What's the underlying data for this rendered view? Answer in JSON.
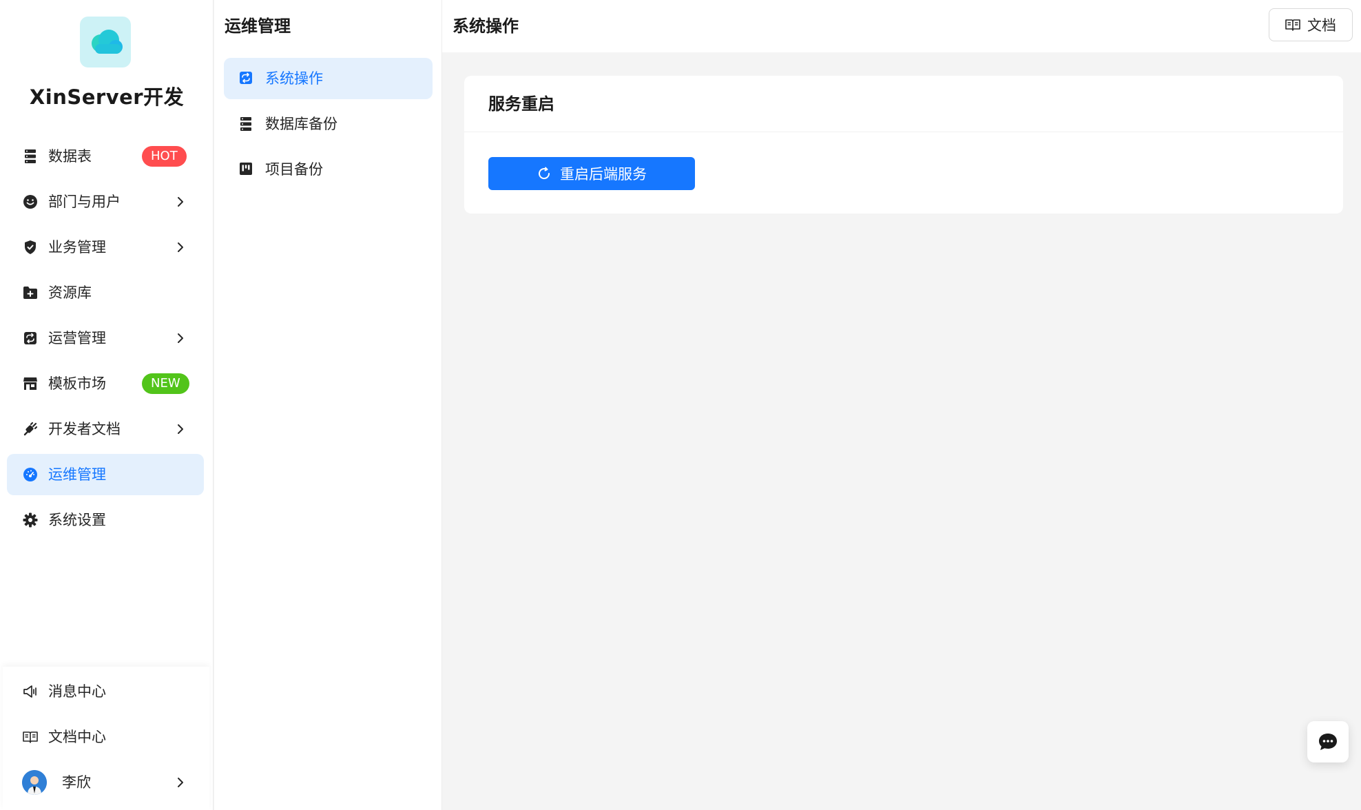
{
  "app": {
    "title": "XinServer开发"
  },
  "sidebar": {
    "items": [
      {
        "label": "数据表",
        "icon": "database-icon",
        "badge": "HOT"
      },
      {
        "label": "部门与用户",
        "icon": "smile-icon"
      },
      {
        "label": "业务管理",
        "icon": "shield-icon"
      },
      {
        "label": "资源库",
        "icon": "folder-add-icon"
      },
      {
        "label": "运营管理",
        "icon": "sync-icon"
      },
      {
        "label": "模板市场",
        "icon": "shop-icon",
        "badge": "NEW"
      },
      {
        "label": "开发者文档",
        "icon": "api-icon"
      },
      {
        "label": "运维管理",
        "icon": "dashboard-icon",
        "active": true
      },
      {
        "label": "系统设置",
        "icon": "setting-icon"
      }
    ],
    "bottom": {
      "messages": "消息中心",
      "docs": "文档中心",
      "user": "李欣"
    }
  },
  "submenu": {
    "title": "运维管理",
    "items": [
      {
        "label": "系统操作",
        "icon": "sync-icon",
        "active": true
      },
      {
        "label": "数据库备份",
        "icon": "database-icon"
      },
      {
        "label": "项目备份",
        "icon": "project-icon"
      }
    ]
  },
  "header": {
    "title": "系统操作",
    "docs_button": "文档"
  },
  "card": {
    "title": "服务重启",
    "button": "重启后端服务"
  },
  "colors": {
    "accent": "#1677ff",
    "active_bg": "#e4f0fd",
    "hot_badge": "#ff4d4f",
    "new_badge": "#52c41a",
    "logo_bg": "#cdf2f6"
  }
}
